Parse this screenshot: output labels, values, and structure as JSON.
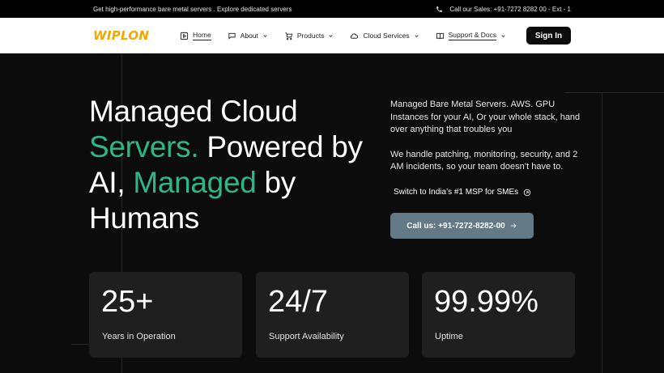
{
  "topbar": {
    "promo_text": "Get high-performance bare metal servers . Explore dedicated servers",
    "sales_text": "Call our Sales: +91-7272 8282 00 - Ext - 1"
  },
  "nav": {
    "logo_text": "WIPLON",
    "items": [
      {
        "label": "Home",
        "icon": "play-square-icon",
        "dropdown": false
      },
      {
        "label": "About",
        "icon": "chat-bubble-icon",
        "dropdown": true
      },
      {
        "label": "Products",
        "icon": "cart-icon",
        "dropdown": true
      },
      {
        "label": "Cloud Services",
        "icon": "cloud-icon",
        "dropdown": true
      },
      {
        "label": "Support & Docs",
        "icon": "book-icon",
        "dropdown": true
      }
    ],
    "signin_label": "Sign In"
  },
  "hero": {
    "headline_line1": "Managed Cloud",
    "headline_accent1": "Servers.",
    "headline_line2_rest": " Powered by",
    "headline_line3_start": "AI, ",
    "headline_accent2": "Managed",
    "headline_line3_rest": " by",
    "headline_line4": "Humans",
    "description_1": "Managed Bare Metal Servers. AWS. GPU Instances for your AI, Or your whole stack, hand over anything that troubles you",
    "description_2": "We handle patching, monitoring, security, and 2 AM incidents, so your team doesn’t have to.",
    "switch_link": "Switch to India’s #1 MSP for SMEs",
    "call_button": "Call us: +91-7272-8282-00",
    "accent_color": "#2fb58a"
  },
  "stats": [
    {
      "value": "25+",
      "label": "Years in Operation"
    },
    {
      "value": "24/7",
      "label": "Support Availability"
    },
    {
      "value": "99.99%",
      "label": "Uptime"
    }
  ]
}
